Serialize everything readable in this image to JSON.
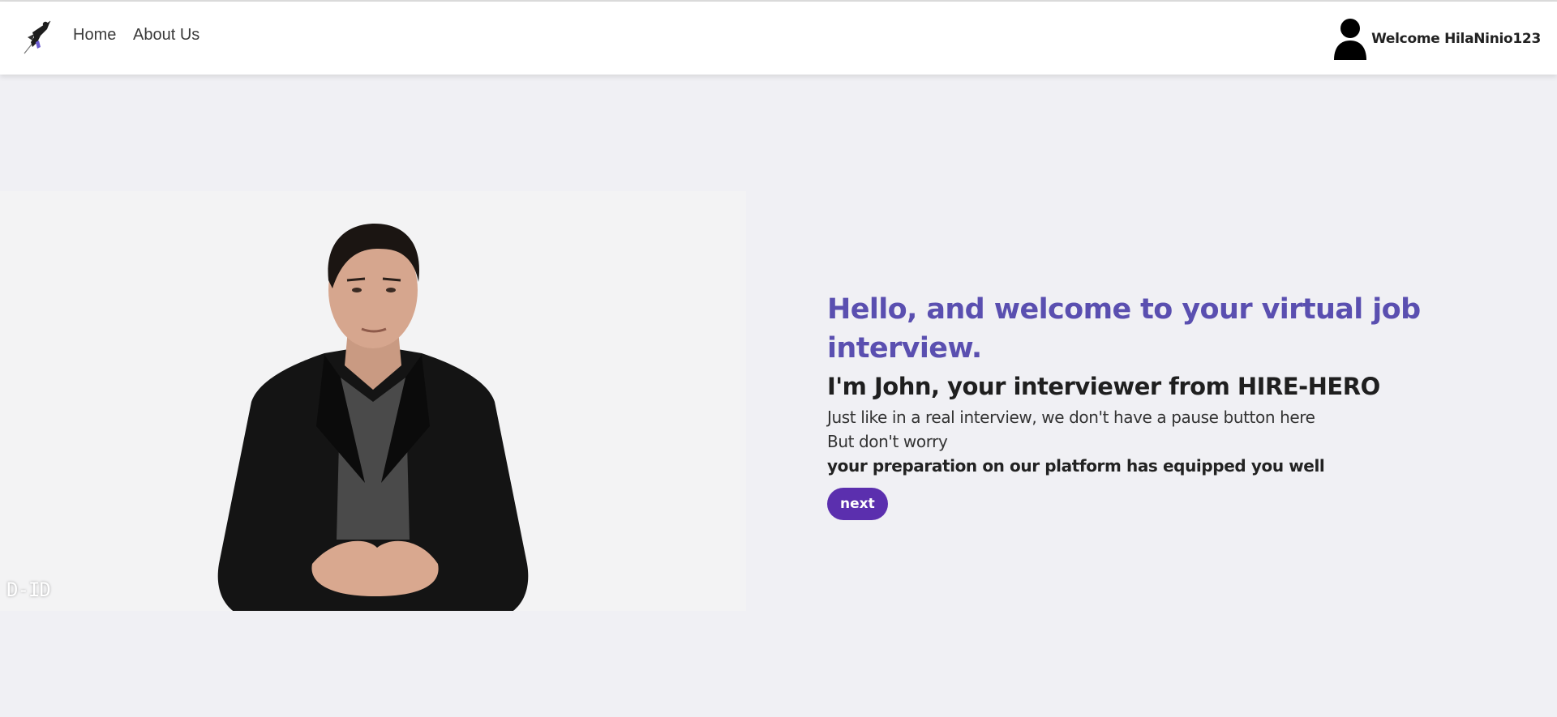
{
  "nav": {
    "logo_icon": "hero-logo-icon",
    "home_label": "Home",
    "about_label": "About Us"
  },
  "user": {
    "avatar_icon": "user-avatar-icon",
    "welcome_text": "Welcome HilaNinio123"
  },
  "video": {
    "watermark": "D-ID"
  },
  "intro": {
    "headline": "Hello, and welcome to your virtual job interview.",
    "subhead": "I'm John, your interviewer from HIRE-HERO",
    "line1": "Just like in a real interview, we don't have a pause button here",
    "line2": "But don't worry",
    "line3": "your preparation on our platform has equipped you well",
    "next_label": "next"
  },
  "colors": {
    "accent_heading": "#5a4fb0",
    "button": "#5b2fae",
    "background": "#f0f0f4"
  }
}
